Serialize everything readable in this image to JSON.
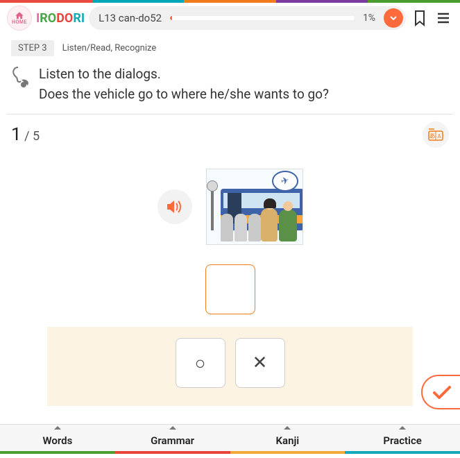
{
  "header": {
    "home_label": "HOME",
    "logo": {
      "l1": "I",
      "l2": "RO",
      "l3": "DO",
      "l4": "RI"
    },
    "lesson_title": "L13 can-do52",
    "progress_pct": "1%"
  },
  "step": {
    "chip": "STEP 3",
    "desc": "Listen/Read, Recognize"
  },
  "instruction": {
    "line1": "Listen to the dialogs.",
    "line2": "Does the vehicle go to where he/she wants to go?"
  },
  "counter": {
    "current": "1",
    "sep": " / ",
    "total": "5"
  },
  "answers": {
    "yes": "○",
    "no": "✕"
  },
  "nav": {
    "words": "Words",
    "grammar": "Grammar",
    "kanji": "Kanji",
    "practice": "Practice"
  }
}
